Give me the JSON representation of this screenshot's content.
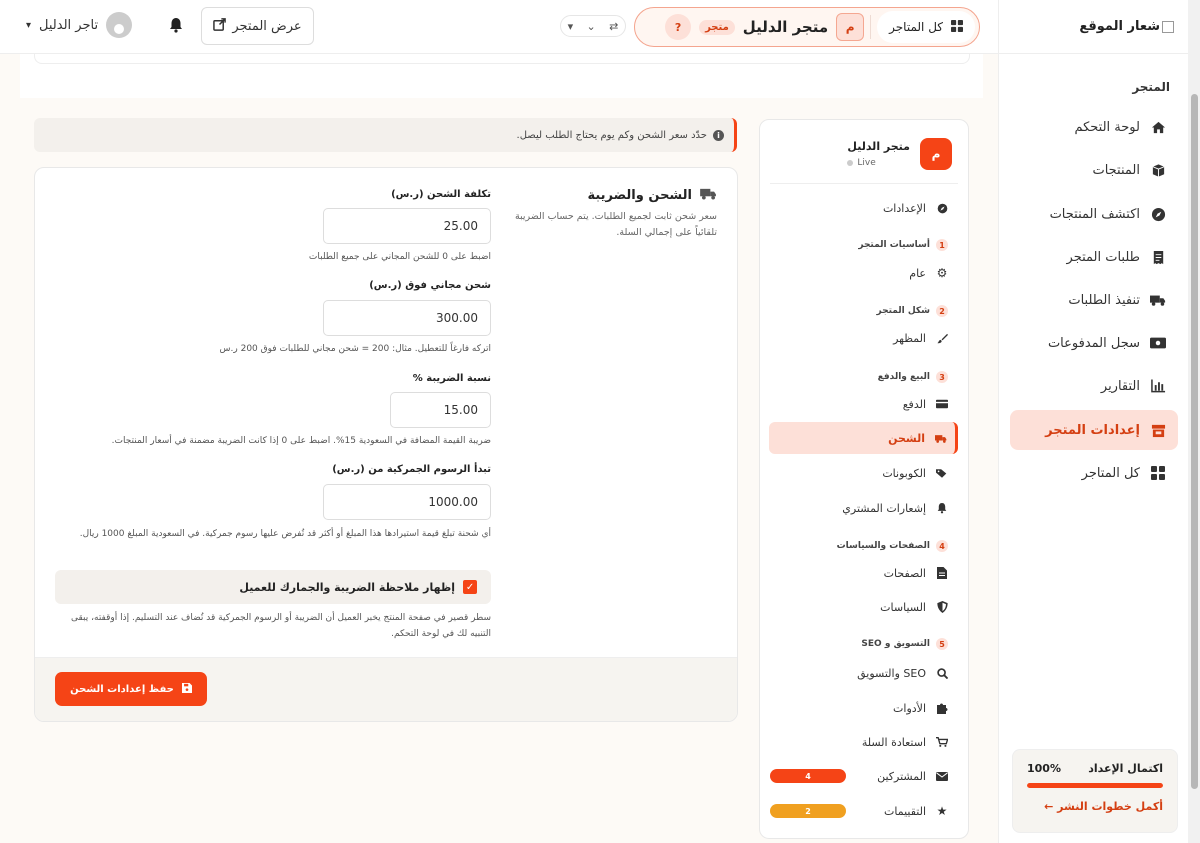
{
  "sidebar": {
    "logo_text": "شعار الموقع",
    "section_title": "المتجر",
    "items": [
      {
        "label": "لوحة التحكم",
        "icon": "home-icon"
      },
      {
        "label": "المنتجات",
        "icon": "box-icon"
      },
      {
        "label": "اكتشف المنتجات",
        "icon": "compass-icon"
      },
      {
        "label": "طلبات المتجر",
        "icon": "receipt-icon"
      },
      {
        "label": "تنفيذ الطلبات",
        "icon": "truck-icon"
      },
      {
        "label": "سجل المدفوعات",
        "icon": "money-icon"
      },
      {
        "label": "التقارير",
        "icon": "chart-icon"
      },
      {
        "label": "إعدادات المتجر",
        "icon": "store-icon",
        "active": true
      },
      {
        "label": "كل المتاجر",
        "icon": "grid-icon"
      }
    ],
    "progress": {
      "label": "اكتمال الإعداد",
      "value_text": "100%",
      "value": 1.0,
      "link": "أكمل خطوات النشر ←"
    }
  },
  "topbar": {
    "all_stores": "كل المتاجر",
    "store_initial": "م",
    "store_name": "متجر الدليل",
    "store_badge": "متجر",
    "help": "?",
    "view_store": "عرض المتجر",
    "user_name": "تاجر الدليل"
  },
  "settings_nav": {
    "store_initial": "م",
    "store_name": "متجر الدليل",
    "status": "Live",
    "items": {
      "settings": "الإعدادات",
      "general": "عام",
      "appearance": "المظهر",
      "payment": "الدفع",
      "shipping": "الشحن",
      "coupons": "الكوبونات",
      "notifications": "إشعارات المشتري",
      "pages": "الصفحات",
      "policies": "السياسات",
      "seo": "SEO والتسويق",
      "tools": "الأدوات",
      "cart_recovery": "استعادة السلة",
      "subscribers": "المشتركين",
      "reviews": "التقييمات"
    },
    "groups": [
      {
        "num": "1",
        "label": "أساسيات المتجر"
      },
      {
        "num": "2",
        "label": "شكل المتجر"
      },
      {
        "num": "3",
        "label": "البيع والدفع"
      },
      {
        "num": "4",
        "label": "الصفحات والسياسات"
      },
      {
        "num": "5",
        "label": "التسويق و SEO"
      }
    ],
    "badges": {
      "subscribers": "4",
      "reviews": "2"
    },
    "colors": {
      "subscribers": "#f54416",
      "reviews": "#f0a020"
    }
  },
  "info_banner": "حدّد سعر الشحن وكم يوم يحتاج الطلب ليصل.",
  "form": {
    "section_title": "الشحن والضريبة",
    "section_desc": "سعر شحن ثابت لجميع الطلبات. يتم حساب الضريبة تلقائياً على إجمالي السلة.",
    "fields": [
      {
        "label": "تكلفة الشحن (ر.س)",
        "value": "25.00",
        "help": "اضبط على 0 للشحن المجاني على جميع الطلبات"
      },
      {
        "label": "شحن مجاني فوق (ر.س)",
        "value": "300.00",
        "help": "اتركه فارغاً للتعطيل. مثال: 200 = شحن مجاني للطلبات فوق 200 ر.س"
      },
      {
        "label": "نسبة الضريبة %",
        "value": "15.00",
        "help": "ضريبة القيمة المضافة في السعودية 15%. اضبط على 0 إذا كانت الضريبة مضمنة في أسعار المنتجات."
      },
      {
        "label": "تبدأ الرسوم الجمركية من (ر.س)",
        "value": "1000.00",
        "help": "أي شحنة تبلغ قيمة استيرادها هذا المبلغ أو أكثر قد تُفرض عليها رسوم جمركية. في السعودية المبلغ 1000 ريال."
      }
    ],
    "checkbox_label": "إظهار ملاحظة الضريبة والجمارك للعميل",
    "checkbox_help": "سطر قصير في صفحة المنتج يخبر العميل أن الضريبة أو الرسوم الجمركية قد تُضاف عند التسليم. إذا أوقفته، يبقى التنبيه لك في لوحة التحكم.",
    "save_label": "حفظ إعدادات الشحن"
  }
}
